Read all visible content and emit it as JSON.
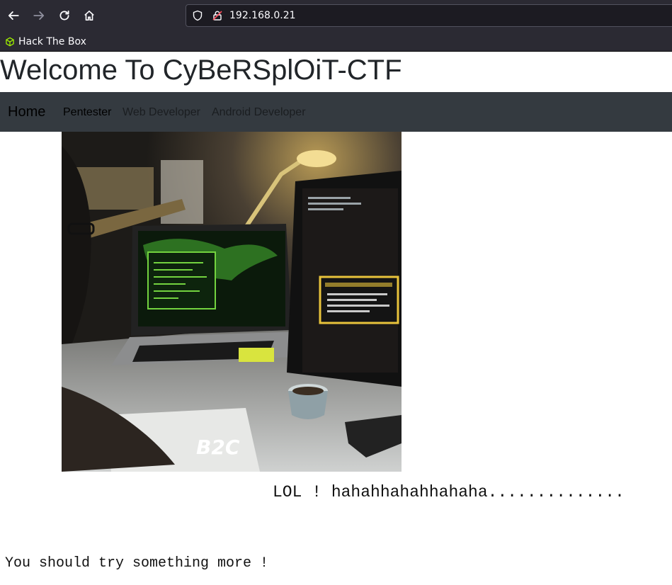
{
  "browser": {
    "url": "192.168.0.21",
    "bookmarks": [
      {
        "label": "Hack The Box"
      }
    ]
  },
  "page": {
    "title": "Welcome To CyBeRSplOiT-CTF",
    "nav": {
      "brand": "Home",
      "links": [
        "Pentester",
        "Web Developer",
        "Android Developer"
      ]
    },
    "image_caption": "B2C",
    "lol_text": "LOL ! hahahhahahhahaha..............",
    "hint_text": "You should try something more !"
  },
  "colors": {
    "browser_chrome": "#2b2a33",
    "navbar": "#343a40",
    "htb_green": "#9fef00"
  }
}
